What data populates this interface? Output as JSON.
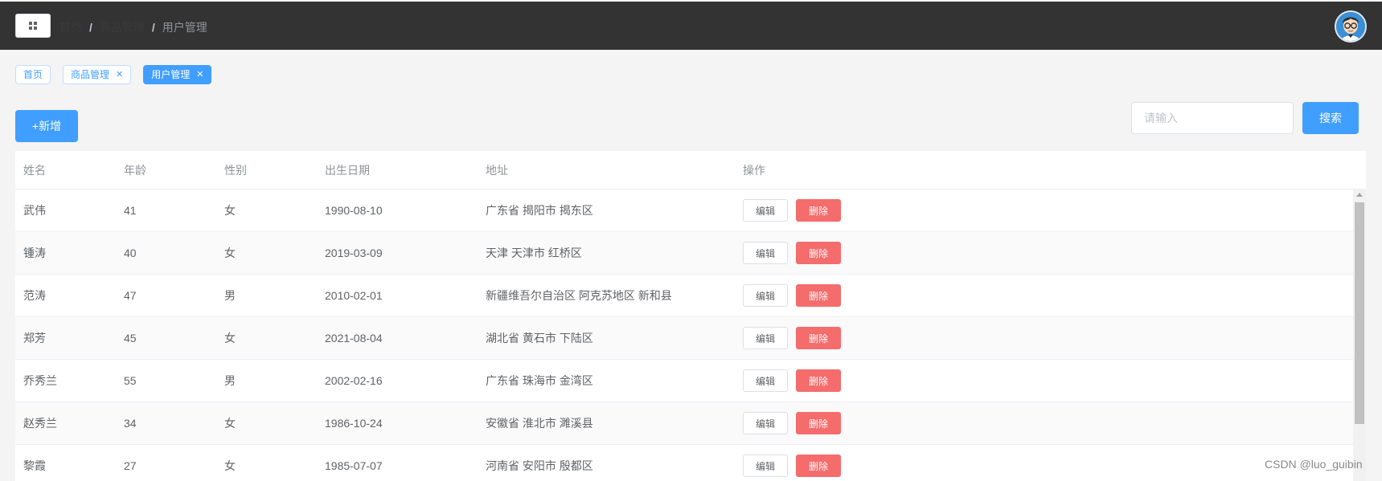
{
  "header": {
    "breadcrumb": [
      {
        "label": "首页"
      },
      {
        "label": "商品管理"
      }
    ],
    "current": "用户管理"
  },
  "tags": [
    {
      "label": "首页",
      "closable": false,
      "active": false
    },
    {
      "label": "商品管理",
      "closable": true,
      "active": false
    },
    {
      "label": "用户管理",
      "closable": true,
      "active": true
    }
  ],
  "toolbar": {
    "add_label": "+新增",
    "search_placeholder": "请输入",
    "search_label": "搜索"
  },
  "table": {
    "columns": [
      "姓名",
      "年龄",
      "性别",
      "出生日期",
      "地址",
      "操作"
    ],
    "edit_label": "编辑",
    "delete_label": "删除",
    "rows": [
      {
        "name": "武伟",
        "age": "41",
        "sex": "女",
        "birth": "1990-08-10",
        "addr": "广东省 揭阳市 揭东区"
      },
      {
        "name": "锺涛",
        "age": "40",
        "sex": "女",
        "birth": "2019-03-09",
        "addr": "天津 天津市 红桥区"
      },
      {
        "name": "范涛",
        "age": "47",
        "sex": "男",
        "birth": "2010-02-01",
        "addr": "新疆维吾尔自治区 阿克苏地区 新和县"
      },
      {
        "name": "郑芳",
        "age": "45",
        "sex": "女",
        "birth": "2021-08-04",
        "addr": "湖北省 黄石市 下陆区"
      },
      {
        "name": "乔秀兰",
        "age": "55",
        "sex": "男",
        "birth": "2002-02-16",
        "addr": "广东省 珠海市 金湾区"
      },
      {
        "name": "赵秀兰",
        "age": "34",
        "sex": "女",
        "birth": "1986-10-24",
        "addr": "安徽省 淮北市 濉溪县"
      },
      {
        "name": "黎霞",
        "age": "27",
        "sex": "女",
        "birth": "1985-07-07",
        "addr": "河南省 安阳市 殷都区"
      }
    ]
  },
  "watermark": "CSDN @luo_guibin",
  "colors": {
    "header_bg": "#333333",
    "primary": "#409eff",
    "danger": "#f56c6c",
    "page_bg": "#f4f4f4"
  }
}
